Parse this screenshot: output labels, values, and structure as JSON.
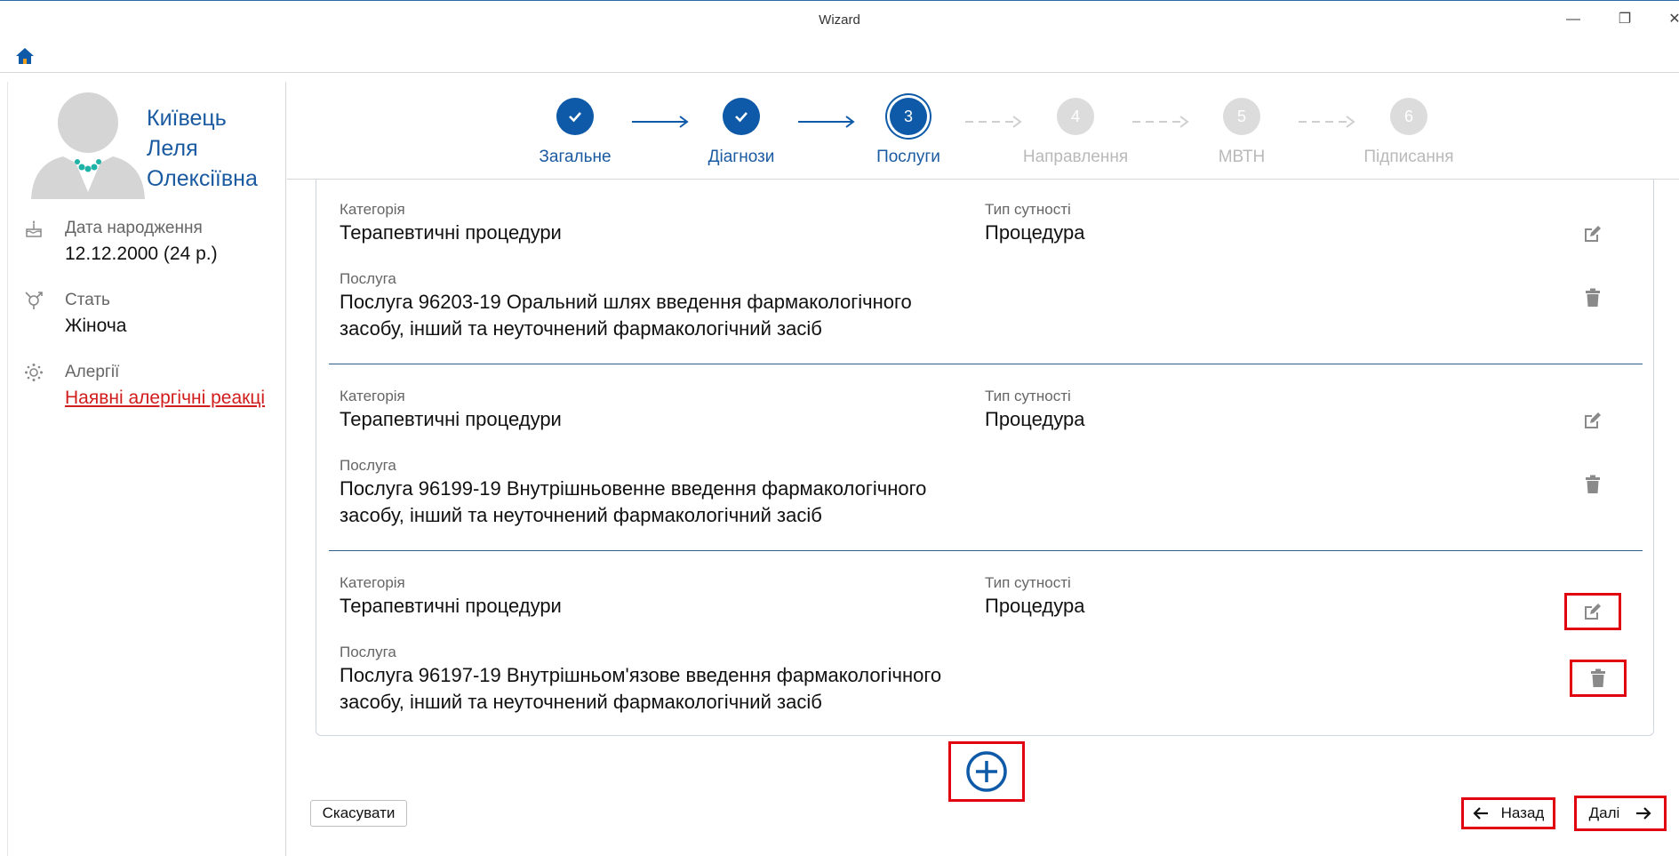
{
  "window": {
    "title": "Wizard",
    "minimize": "—",
    "maximize": "❐",
    "close": "✕"
  },
  "patient": {
    "name_line1": "Київець",
    "name_line2": "Леля",
    "name_line3": "Олексіївна",
    "birth_label": "Дата народження",
    "birth_value": "12.12.2000 (24 р.)",
    "sex_label": "Стать",
    "sex_value": "Жіноча",
    "allergy_label": "Алергії",
    "allergy_link": "Наявні алергічні реакці"
  },
  "stepper": {
    "steps": [
      {
        "number": "",
        "label": "Загальне",
        "state": "done"
      },
      {
        "number": "",
        "label": "Діагнози",
        "state": "done"
      },
      {
        "number": "3",
        "label": "Послуги",
        "state": "current"
      },
      {
        "number": "4",
        "label": "Направлення",
        "state": "todo"
      },
      {
        "number": "5",
        "label": "МВТН",
        "state": "todo"
      },
      {
        "number": "6",
        "label": "Підписання",
        "state": "todo"
      }
    ]
  },
  "services": {
    "items": [
      {
        "category_label": "Категорія",
        "category_value": "Терапевтичні процедури",
        "type_label": "Тип сутності",
        "type_value": "Процедура",
        "service_label": "Послуга",
        "service_line1": "Послуга 96203-19 Оральний шлях введення фармакологічного",
        "service_line2": "засобу, інший та неуточнений фармакологічний засіб"
      },
      {
        "category_label": "Категорія",
        "category_value": "Терапевтичні процедури",
        "type_label": "Тип сутності",
        "type_value": "Процедура",
        "service_label": "Послуга",
        "service_line1": "Послуга 96199-19 Внутрішньовенне введення фармакологічного",
        "service_line2": "засобу, інший та неуточнений фармакологічний засіб"
      },
      {
        "category_label": "Категорія",
        "category_value": "Терапевтичні процедури",
        "type_label": "Тип сутності",
        "type_value": "Процедура",
        "service_label": "Послуга",
        "service_line1": "Послуга 96197-19 Внутрішньом'язове введення фармакологічного",
        "service_line2": "засобу, інший та неуточнений фармакологічний засіб"
      }
    ]
  },
  "footer": {
    "cancel_label": "Скасувати",
    "back_label": "Назад",
    "next_label": "Далі"
  },
  "colors": {
    "accent": "#0e5aa8",
    "highlight": "#e10010",
    "link_red": "#d11c1c"
  }
}
